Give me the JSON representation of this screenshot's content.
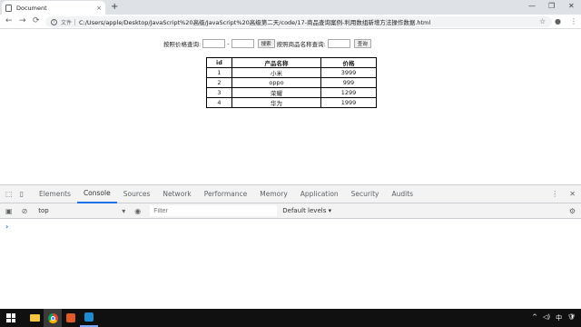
{
  "browser": {
    "tab_title": "Document",
    "tab_close": "×",
    "new_tab": "+",
    "window_controls": [
      "—",
      "❐",
      "✕"
    ],
    "nav": {
      "back": "←",
      "forward": "→",
      "reload": "⟳"
    },
    "address": {
      "info": "i",
      "scheme_label": "文件",
      "url": "C:/Users/apple/Desktop/JavaScript%20高级/JavaScript%20高级第二天/code/17-商品查询案例-利用数组新增方法操作数据.html"
    },
    "right_icons": {
      "star": "☆",
      "account": "●",
      "menu": "⋮"
    }
  },
  "page": {
    "price_label": "按照价格查询:",
    "range_sep": "-",
    "search_button": "搜索",
    "name_label": "按照商品名称查询:",
    "query_button": "查询",
    "price_min_value": "",
    "price_max_value": "",
    "name_value": "",
    "table": {
      "headers": [
        "id",
        "产品名称",
        "价格"
      ],
      "rows": [
        [
          "1",
          "小米",
          "3999"
        ],
        [
          "2",
          "oppo",
          "999"
        ],
        [
          "3",
          "荣耀",
          "1299"
        ],
        [
          "4",
          "华为",
          "1999"
        ]
      ]
    }
  },
  "devtools": {
    "tabs": [
      "Elements",
      "Console",
      "Sources",
      "Network",
      "Performance",
      "Memory",
      "Application",
      "Security",
      "Audits"
    ],
    "active_tab": "Console",
    "context": "top",
    "filter_placeholder": "Filter",
    "levels": "Default levels ▾",
    "prompt": "›",
    "icons": {
      "inspect": "⬚",
      "device": "▯",
      "more": "⋮",
      "close": "✕",
      "sidebar": "▣",
      "clear": "⊘",
      "eye": "◉",
      "settings": "⚙",
      "dropdown": "▾"
    }
  },
  "taskbar": {
    "tray": [
      "^",
      "◁)",
      "中",
      "🛡"
    ]
  }
}
